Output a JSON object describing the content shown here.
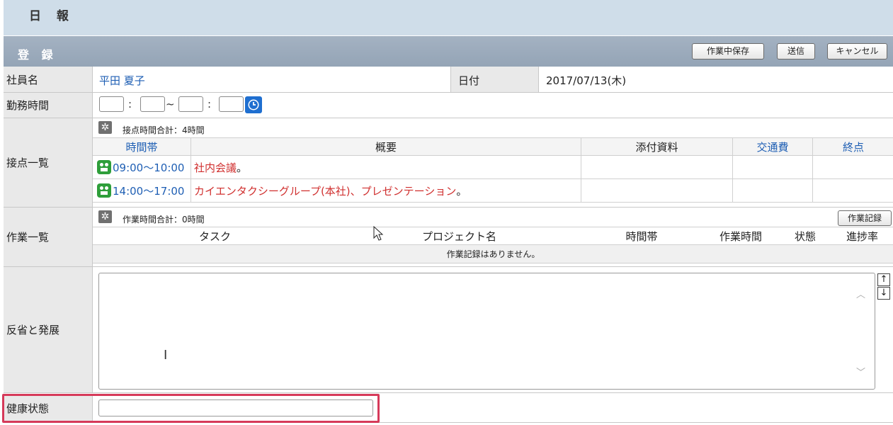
{
  "header": {
    "title": "日 報"
  },
  "section": {
    "title": "登 録",
    "buttons": {
      "save_draft": "作業中保存",
      "send": "送信",
      "cancel": "キャンセル"
    }
  },
  "employee": {
    "label": "社員名",
    "value": "平田 夏子",
    "date_label": "日付",
    "date_value": "2017/07/13(木)"
  },
  "work_hours": {
    "label": "勤務時間",
    "colon": ":",
    "tilde": "~"
  },
  "contacts": {
    "label": "接点一覧",
    "summary": "接点時間合計：4時間",
    "columns": [
      "時間帯",
      "概要",
      "添付資料",
      "交通費",
      "終点"
    ],
    "rows": [
      {
        "time": "09:00～10:00",
        "summary": "社内会議",
        "suffix": "。"
      },
      {
        "time": "14:00～17:00",
        "summary": "カイエンタクシーグループ(本社)、プレゼンテーション",
        "suffix": "。"
      }
    ]
  },
  "tasks": {
    "label": "作業一覧",
    "summary": "作業時間合計：0時間",
    "record_button": "作業記録",
    "columns": [
      "タスク",
      "プロジェクト名",
      "時間帯",
      "作業時間",
      "状態",
      "進捗率"
    ],
    "empty_message": "作業記録はありません。"
  },
  "reflection": {
    "label": "反省と発展",
    "value": ""
  },
  "health": {
    "label": "健康状態",
    "value": ""
  },
  "colors": {
    "accent_blue": "#1f5fb4",
    "accent_red": "#d0302f",
    "highlight": "#d63a5a",
    "icon_green": "#2e9e3a"
  }
}
